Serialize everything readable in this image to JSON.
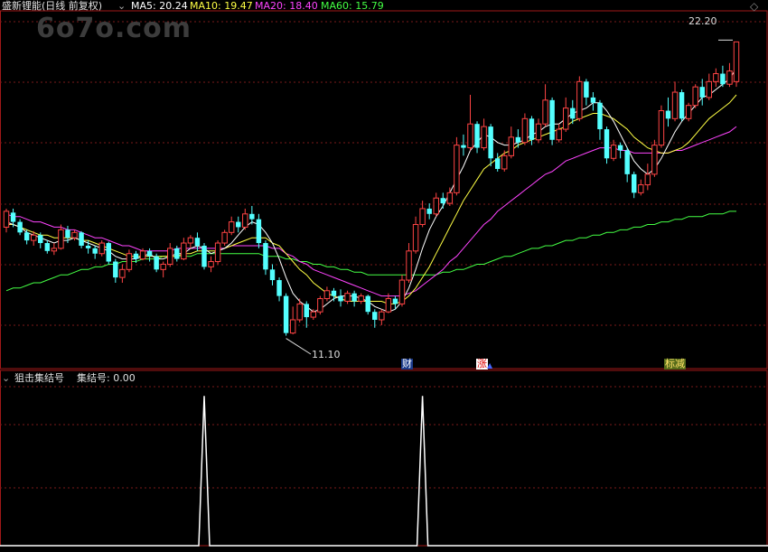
{
  "header": {
    "stock_title": "盛新锂能(日线 前复权)",
    "ma5_label": "MA5: 20.24",
    "ma10_label": "MA10: 19.47",
    "ma20_label": "MA20: 18.40",
    "ma60_label": "MA60: 15.79",
    "ma5_color": "#ffffff",
    "ma10_color": "#ffff44",
    "ma20_color": "#ff44ff",
    "ma60_color": "#44ff44"
  },
  "watermark": "6o7o.com",
  "annotations": {
    "high_label": "22.20",
    "low_label": "11.10",
    "event_cai": "财",
    "event_zhang": "涨",
    "event_biaojian": "标减"
  },
  "indicator": {
    "title": "狙击集结号",
    "value_label": "集结号: 0.00"
  },
  "colors": {
    "up": "#ff4444",
    "down": "#54ffff",
    "grid": "#7a1a1a",
    "border": "#a01818",
    "signal": "#ffffff"
  },
  "chart_data": [
    {
      "type": "candlestick",
      "title": "盛新锂能(日线 前复权)",
      "y_range": [
        10.3,
        23.1
      ],
      "high": 22.2,
      "low": 11.1,
      "candles": [
        [
          15.2,
          15.8,
          15.0,
          15.9
        ],
        [
          15.75,
          15.4,
          15.2,
          15.9
        ],
        [
          15.4,
          15.0,
          14.9,
          15.5
        ],
        [
          15.0,
          14.7,
          14.55,
          15.1
        ],
        [
          14.7,
          14.9,
          14.5,
          15.05
        ],
        [
          14.9,
          14.6,
          14.4,
          15.0
        ],
        [
          14.6,
          14.3,
          14.2,
          14.7
        ],
        [
          14.3,
          14.4,
          14.15,
          14.6
        ],
        [
          14.4,
          15.1,
          14.35,
          15.3
        ],
        [
          15.1,
          14.8,
          14.6,
          15.25
        ],
        [
          14.8,
          15.0,
          14.7,
          15.1
        ],
        [
          15.0,
          14.5,
          14.4,
          15.05
        ],
        [
          14.5,
          14.4,
          14.2,
          14.7
        ],
        [
          14.4,
          14.2,
          14.0,
          14.5
        ],
        [
          14.2,
          14.6,
          14.1,
          14.7
        ],
        [
          14.6,
          13.9,
          13.8,
          14.65
        ],
        [
          13.9,
          13.3,
          13.1,
          14.0
        ],
        [
          13.3,
          13.6,
          13.1,
          13.8
        ],
        [
          13.6,
          14.2,
          13.5,
          14.35
        ],
        [
          14.2,
          14.0,
          13.85,
          14.3
        ],
        [
          14.0,
          14.3,
          13.95,
          14.4
        ],
        [
          14.3,
          14.1,
          13.9,
          14.4
        ],
        [
          14.1,
          13.6,
          13.5,
          14.2
        ],
        [
          13.6,
          13.8,
          13.3,
          13.9
        ],
        [
          13.8,
          14.4,
          13.7,
          14.6
        ],
        [
          14.4,
          14.0,
          13.9,
          14.5
        ],
        [
          14.0,
          14.6,
          13.95,
          14.8
        ],
        [
          14.6,
          14.8,
          14.4,
          14.9
        ],
        [
          14.8,
          14.5,
          14.3,
          15.0
        ],
        [
          14.5,
          13.7,
          13.6,
          14.6
        ],
        [
          13.7,
          13.9,
          13.5,
          14.1
        ],
        [
          13.9,
          14.6,
          13.8,
          14.7
        ],
        [
          14.6,
          15.0,
          14.5,
          15.1
        ],
        [
          15.0,
          15.4,
          14.9,
          15.6
        ],
        [
          15.4,
          15.2,
          15.0,
          15.6
        ],
        [
          15.2,
          15.7,
          15.1,
          15.9
        ],
        [
          15.7,
          15.5,
          15.3,
          16.0
        ],
        [
          15.5,
          14.6,
          14.4,
          15.7
        ],
        [
          14.6,
          13.6,
          13.4,
          14.7
        ],
        [
          13.6,
          13.2,
          13.0,
          13.8
        ],
        [
          13.2,
          12.6,
          12.4,
          13.3
        ],
        [
          12.6,
          11.2,
          11.1,
          12.7
        ],
        [
          11.2,
          11.7,
          11.15,
          12.2
        ],
        [
          11.7,
          12.3,
          11.6,
          12.5
        ],
        [
          12.3,
          11.8,
          11.4,
          12.4
        ],
        [
          11.8,
          12.0,
          11.7,
          12.1
        ],
        [
          12.0,
          12.5,
          11.9,
          12.6
        ],
        [
          12.5,
          12.8,
          12.4,
          12.95
        ],
        [
          12.8,
          12.6,
          12.4,
          12.9
        ],
        [
          12.6,
          12.4,
          12.2,
          12.85
        ],
        [
          12.4,
          12.7,
          12.3,
          12.8
        ],
        [
          12.7,
          12.4,
          12.2,
          12.8
        ],
        [
          12.4,
          12.6,
          12.3,
          12.7
        ],
        [
          12.6,
          12.0,
          11.9,
          12.65
        ],
        [
          12.0,
          11.7,
          11.4,
          12.1
        ],
        [
          11.7,
          12.0,
          11.5,
          12.1
        ],
        [
          12.0,
          12.5,
          11.95,
          12.7
        ],
        [
          12.5,
          12.3,
          12.1,
          12.6
        ],
        [
          12.3,
          13.2,
          12.2,
          13.4
        ],
        [
          13.2,
          14.3,
          13.1,
          14.6
        ],
        [
          14.3,
          15.3,
          14.2,
          15.6
        ],
        [
          15.3,
          15.9,
          15.2,
          16.2
        ],
        [
          15.9,
          15.7,
          15.5,
          16.1
        ],
        [
          15.7,
          16.3,
          15.6,
          16.5
        ],
        [
          16.3,
          16.1,
          15.9,
          16.5
        ],
        [
          16.1,
          16.5,
          16.0,
          16.7
        ],
        [
          16.5,
          18.3,
          16.4,
          18.6
        ],
        [
          18.3,
          18.2,
          17.9,
          18.7
        ],
        [
          18.2,
          19.1,
          18.1,
          20.2
        ],
        [
          19.1,
          18.2,
          18.0,
          19.2
        ],
        [
          18.2,
          19.0,
          18.1,
          19.3
        ],
        [
          19.0,
          17.8,
          17.5,
          19.1
        ],
        [
          17.8,
          17.4,
          17.3,
          18.0
        ],
        [
          17.4,
          17.9,
          17.3,
          18.1
        ],
        [
          17.9,
          18.6,
          17.8,
          19.0
        ],
        [
          18.6,
          18.4,
          18.2,
          18.9
        ],
        [
          18.4,
          19.3,
          18.3,
          19.5
        ],
        [
          19.3,
          18.5,
          18.3,
          19.4
        ],
        [
          18.5,
          19.1,
          18.4,
          19.3
        ],
        [
          19.1,
          20.0,
          19.0,
          20.6
        ],
        [
          20.0,
          18.5,
          18.3,
          20.1
        ],
        [
          18.5,
          18.9,
          18.4,
          19.1
        ],
        [
          18.9,
          19.7,
          18.8,
          20.1
        ],
        [
          19.7,
          19.3,
          19.1,
          20.0
        ],
        [
          19.3,
          20.7,
          19.2,
          20.9
        ],
        [
          20.7,
          20.1,
          19.8,
          20.8
        ],
        [
          20.1,
          19.9,
          19.6,
          20.3
        ],
        [
          19.9,
          18.9,
          18.5,
          20.0
        ],
        [
          18.9,
          17.8,
          17.6,
          19.0
        ],
        [
          17.8,
          18.3,
          17.7,
          18.5
        ],
        [
          18.3,
          18.1,
          17.8,
          18.4
        ],
        [
          18.1,
          17.2,
          16.9,
          18.2
        ],
        [
          17.2,
          16.5,
          16.3,
          17.3
        ],
        [
          16.5,
          16.8,
          16.4,
          17.0
        ],
        [
          16.8,
          17.2,
          16.6,
          17.6
        ],
        [
          17.2,
          18.3,
          17.1,
          18.5
        ],
        [
          18.3,
          19.6,
          18.2,
          19.8
        ],
        [
          19.6,
          19.3,
          19.0,
          20.1
        ],
        [
          19.3,
          20.3,
          19.2,
          20.7
        ],
        [
          20.3,
          19.3,
          19.2,
          20.4
        ],
        [
          19.3,
          19.8,
          19.2,
          19.9
        ],
        [
          19.8,
          20.5,
          19.7,
          20.6
        ],
        [
          20.5,
          20.1,
          19.8,
          20.8
        ],
        [
          20.1,
          20.7,
          20.0,
          21.0
        ],
        [
          20.7,
          21.0,
          20.5,
          21.2
        ],
        [
          21.0,
          20.6,
          20.5,
          21.3
        ],
        [
          20.6,
          21.1,
          20.5,
          21.4
        ],
        [
          20.7,
          22.2,
          20.5,
          22.2
        ]
      ],
      "ma5": [
        15.4,
        15.3,
        15.2,
        15.0,
        14.9,
        14.8,
        14.7,
        14.6,
        14.7,
        14.7,
        14.8,
        14.7,
        14.6,
        14.5,
        14.4,
        14.3,
        14.1,
        14.0,
        14.0,
        14.0,
        14.1,
        14.2,
        14.0,
        14.0,
        14.1,
        14.2,
        14.2,
        14.4,
        14.5,
        14.4,
        14.2,
        14.3,
        14.4,
        14.6,
        14.9,
        15.2,
        15.4,
        15.3,
        15.0,
        14.6,
        14.0,
        13.3,
        12.7,
        12.4,
        12.2,
        12.0,
        12.1,
        12.3,
        12.5,
        12.6,
        12.6,
        12.6,
        12.5,
        12.4,
        12.2,
        12.1,
        12.0,
        12.1,
        12.4,
        12.9,
        13.6,
        14.4,
        15.1,
        15.6,
        16.0,
        16.5,
        17.0,
        17.5,
        18.1,
        18.4,
        18.7,
        18.6,
        18.4,
        18.3,
        18.3,
        18.4,
        18.5,
        18.7,
        18.8,
        19.0,
        19.1,
        19.1,
        19.3,
        19.5,
        19.6,
        19.7,
        19.9,
        19.9,
        19.6,
        19.2,
        18.7,
        18.2,
        17.7,
        17.4,
        17.2,
        17.4,
        17.8,
        18.3,
        18.8,
        19.2,
        19.5,
        19.8,
        20.1,
        20.2,
        20.4,
        20.6,
        20.8,
        21.2
      ],
      "ma10": [
        15.3,
        15.3,
        15.2,
        15.1,
        15.0,
        14.9,
        14.9,
        14.8,
        14.8,
        14.8,
        14.8,
        14.7,
        14.7,
        14.6,
        14.5,
        14.4,
        14.3,
        14.2,
        14.1,
        14.1,
        14.1,
        14.1,
        14.1,
        14.1,
        14.1,
        14.1,
        14.2,
        14.2,
        14.3,
        14.3,
        14.3,
        14.3,
        14.4,
        14.5,
        14.6,
        14.7,
        14.8,
        14.8,
        14.8,
        14.6,
        14.5,
        14.2,
        13.9,
        13.6,
        13.4,
        13.1,
        12.9,
        12.7,
        12.6,
        12.5,
        12.4,
        12.4,
        12.4,
        12.4,
        12.4,
        12.4,
        12.3,
        12.3,
        12.4,
        12.6,
        12.9,
        13.3,
        13.7,
        14.2,
        14.7,
        15.2,
        15.7,
        16.2,
        16.6,
        17.0,
        17.4,
        17.6,
        17.8,
        18.0,
        18.1,
        18.3,
        18.4,
        18.5,
        18.6,
        18.7,
        18.8,
        18.9,
        19.0,
        19.2,
        19.3,
        19.4,
        19.5,
        19.5,
        19.4,
        19.3,
        19.1,
        18.9,
        18.6,
        18.4,
        18.2,
        18.1,
        18.0,
        18.0,
        18.1,
        18.2,
        18.4,
        18.7,
        19.0,
        19.3,
        19.5,
        19.7,
        19.9,
        20.2
      ],
      "ma20": [
        15.7,
        15.6,
        15.6,
        15.5,
        15.4,
        15.4,
        15.3,
        15.2,
        15.2,
        15.1,
        15.1,
        15.0,
        14.9,
        14.8,
        14.8,
        14.7,
        14.6,
        14.5,
        14.5,
        14.4,
        14.3,
        14.3,
        14.3,
        14.3,
        14.3,
        14.4,
        14.4,
        14.4,
        14.4,
        14.4,
        14.4,
        14.4,
        14.4,
        14.5,
        14.5,
        14.5,
        14.5,
        14.5,
        14.5,
        14.4,
        14.4,
        14.2,
        14.1,
        13.9,
        13.8,
        13.6,
        13.5,
        13.4,
        13.3,
        13.2,
        13.1,
        13.0,
        12.9,
        12.8,
        12.7,
        12.6,
        12.6,
        12.6,
        12.6,
        12.7,
        12.8,
        13.0,
        13.2,
        13.4,
        13.6,
        13.9,
        14.1,
        14.4,
        14.7,
        15.0,
        15.3,
        15.5,
        15.8,
        16.0,
        16.2,
        16.4,
        16.6,
        16.8,
        17.0,
        17.2,
        17.3,
        17.5,
        17.7,
        17.8,
        17.9,
        18.0,
        18.1,
        18.2,
        18.2,
        18.2,
        18.1,
        18.1,
        18.0,
        18.0,
        18.0,
        18.0,
        18.0,
        18.0,
        18.1,
        18.1,
        18.2,
        18.3,
        18.4,
        18.5,
        18.6,
        18.7,
        18.8,
        19.0
      ],
      "ma60": [
        12.8,
        12.9,
        12.9,
        13.0,
        13.1,
        13.1,
        13.2,
        13.3,
        13.4,
        13.4,
        13.5,
        13.6,
        13.6,
        13.7,
        13.7,
        13.8,
        13.8,
        13.9,
        13.9,
        13.9,
        14.0,
        14.0,
        14.0,
        14.1,
        14.1,
        14.1,
        14.1,
        14.1,
        14.2,
        14.2,
        14.2,
        14.2,
        14.2,
        14.2,
        14.2,
        14.2,
        14.2,
        14.2,
        14.1,
        14.1,
        14.1,
        14.0,
        14.0,
        13.9,
        13.9,
        13.8,
        13.8,
        13.7,
        13.7,
        13.6,
        13.6,
        13.5,
        13.5,
        13.4,
        13.4,
        13.4,
        13.4,
        13.4,
        13.4,
        13.4,
        13.4,
        13.4,
        13.4,
        13.4,
        13.5,
        13.5,
        13.6,
        13.6,
        13.7,
        13.8,
        13.8,
        13.9,
        14.0,
        14.1,
        14.1,
        14.2,
        14.3,
        14.4,
        14.4,
        14.5,
        14.5,
        14.6,
        14.7,
        14.7,
        14.8,
        14.8,
        14.9,
        14.9,
        15.0,
        15.0,
        15.1,
        15.1,
        15.2,
        15.2,
        15.3,
        15.3,
        15.4,
        15.4,
        15.5,
        15.5,
        15.6,
        15.6,
        15.6,
        15.7,
        15.7,
        15.7,
        15.8,
        15.8
      ]
    },
    {
      "type": "line",
      "title": "狙击集结号",
      "series": [
        {
          "name": "集结号",
          "spikes_at": [
            29,
            61
          ],
          "spike_value": 1,
          "base_value": 0
        }
      ],
      "ylim": [
        0,
        1.05
      ]
    }
  ]
}
